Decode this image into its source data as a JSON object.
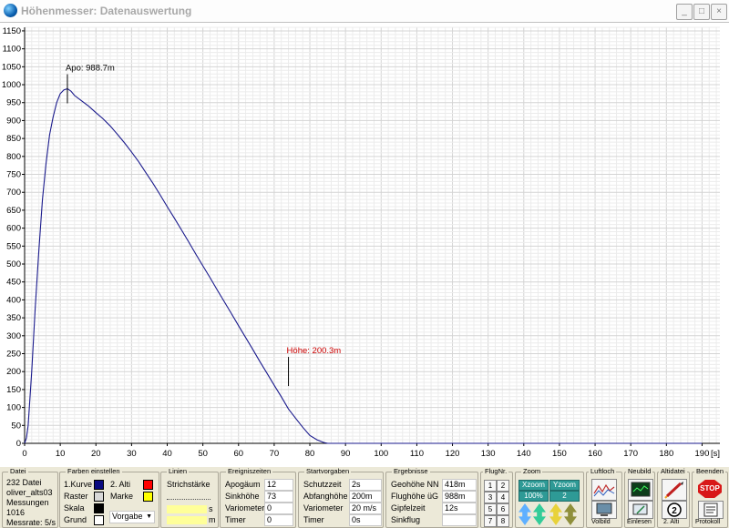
{
  "window": {
    "title": "Höhenmesser: Datenauswertung",
    "buttons": {
      "minimize": "_",
      "maximize": "□",
      "close": "×"
    }
  },
  "chart_data": {
    "type": "line",
    "title": "",
    "xlabel": "[s]",
    "ylabel": "",
    "xlim": [
      0,
      195
    ],
    "ylim": [
      0,
      1160
    ],
    "x_ticks": [
      0,
      10,
      20,
      30,
      40,
      50,
      60,
      70,
      80,
      90,
      100,
      110,
      120,
      130,
      140,
      150,
      160,
      170,
      180,
      190
    ],
    "y_ticks": [
      0,
      50,
      100,
      150,
      200,
      250,
      300,
      350,
      400,
      450,
      500,
      550,
      600,
      650,
      700,
      750,
      800,
      850,
      900,
      950,
      1000,
      1050,
      1100,
      1150
    ],
    "grid": true,
    "series": [
      {
        "color": "#1a1a8c",
        "x": [
          0,
          0.5,
          1,
          2,
          3,
          4,
          5,
          6,
          7,
          8,
          9,
          10,
          11,
          12,
          13,
          14,
          16,
          18,
          20,
          22,
          24,
          26,
          28,
          30,
          32,
          34,
          36,
          38,
          40,
          42,
          44,
          46,
          48,
          50,
          52,
          54,
          56,
          58,
          60,
          62,
          64,
          66,
          68,
          70,
          72,
          74,
          76,
          78,
          80,
          82,
          84,
          85,
          86,
          90,
          100,
          110,
          120,
          130,
          140,
          150,
          160,
          170,
          180,
          190
        ],
        "y": [
          0,
          15,
          50,
          200,
          380,
          540,
          680,
          780,
          860,
          910,
          950,
          975,
          985,
          988.7,
          982,
          970,
          955,
          940,
          922,
          905,
          885,
          862,
          838,
          812,
          785,
          755,
          725,
          693,
          660,
          628,
          595,
          562,
          528,
          495,
          462,
          428,
          395,
          362,
          328,
          295,
          262,
          228,
          195,
          162,
          130,
          96,
          70,
          45,
          22,
          10,
          2,
          0,
          0,
          0,
          0,
          0,
          0,
          0,
          0,
          0,
          0,
          0,
          0,
          0
        ]
      }
    ],
    "annotations": [
      {
        "text": "Apo: 988.7m",
        "x": 12,
        "y": 988.7,
        "color": "#000000"
      },
      {
        "text": "Höhe: 200.3m",
        "x": 74,
        "y": 200.3,
        "color": "#cc0000"
      }
    ]
  },
  "panels": {
    "datei": {
      "title": "Datei",
      "file": "232 Datei",
      "name": "oliver_alts03",
      "messungen_label": "Messungen",
      "messungen": "1016",
      "messrate": "Messrate: 5/s"
    },
    "farben": {
      "title": "Farben einstellen",
      "kurve1": "1.Kurve",
      "raster": "Raster",
      "skala": "Skala",
      "grund": "Grund",
      "alti2": "2. Alti",
      "marke": "Marke",
      "vorgabe": "Vorgabe",
      "colors": {
        "kurve1": "#0a0a80",
        "raster": "#d8d8d8",
        "skala": "#000000",
        "grund": "#ffffff",
        "alti2": "#ff0000",
        "marke": "#ffff00"
      }
    },
    "linien": {
      "title": "Linien",
      "strichstaerke": "Strichstärke",
      "unit_s": "s",
      "unit_m": "m"
    },
    "ereignis": {
      "title": "Ereigniszeiten",
      "apogaeum": "Apogäum",
      "apogaeum_val": "12",
      "sinkhoehe": "Sinkhöhe",
      "sinkhoehe_val": "73",
      "variometer": "Variometer",
      "variometer_val": "0",
      "timer": "Timer",
      "timer_val": "0"
    },
    "start": {
      "title": "Startvorgaben",
      "schutzzeit": "Schutzzeit",
      "schutzzeit_val": "2s",
      "abfanghoehe": "Abfanghöhe",
      "abfanghoehe_val": "200m",
      "variometer": "Variometer",
      "variometer_val": "20 m/s",
      "timer": "Timer",
      "timer_val": "0s"
    },
    "ergebnisse": {
      "title": "Ergebnisse",
      "geohoehe": "Geohöhe NN",
      "geohoehe_val": "418m",
      "flughoehe": "Flughöhe üG",
      "flughoehe_val": "988m",
      "gipfelzeit": "Gipfelzeit",
      "gipfelzeit_val": "12s",
      "sinkflug": "Sinkflug",
      "sinkflug_val": ""
    },
    "flugnr": {
      "title": "FlugNr.",
      "buttons": [
        "1",
        "2",
        "3",
        "4",
        "5",
        "6",
        "7",
        "8"
      ]
    },
    "zoom": {
      "title": "Zoom",
      "xzoom": "Xzoom",
      "yzoom": "Yzoom",
      "xval": "100%",
      "yval": "2"
    },
    "luftloch": {
      "title": "Luftloch",
      "label": "Volbild"
    },
    "neubild": {
      "title": "Neubild",
      "label": "Einlesen"
    },
    "altidatei": {
      "title": "Altidatei",
      "label": "2. Alti",
      "number": "2"
    },
    "beenden": {
      "title": "Beenden",
      "stop": "STOP",
      "label": "Protokoll"
    }
  }
}
